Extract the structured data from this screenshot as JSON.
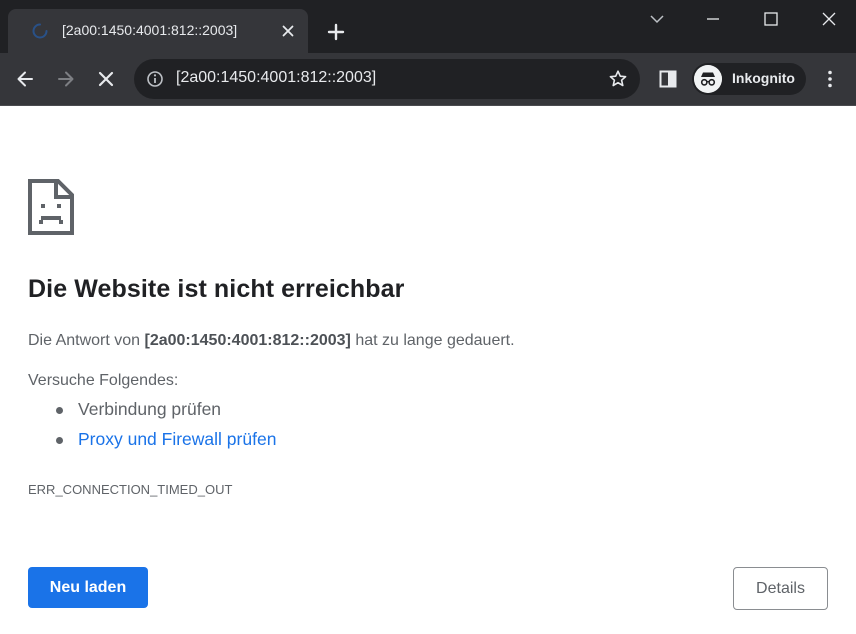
{
  "tab": {
    "title": "[2a00:1450:4001:812::2003]"
  },
  "omnibox": {
    "url": "[2a00:1450:4001:812::2003]"
  },
  "profile": {
    "label": "Inkognito"
  },
  "icons": {
    "tab_loading": "spinner-icon",
    "tab_close": "close-icon",
    "new_tab": "plus-icon",
    "tab_search": "chevron-down-icon",
    "minimize": "minimize-icon",
    "maximize": "maximize-icon",
    "close_window": "close-icon",
    "back": "arrow-left-icon",
    "forward": "arrow-right-icon",
    "stop": "close-icon",
    "site_info": "info-icon",
    "bookmark": "star-icon",
    "side_panel": "side-panel-icon",
    "incognito": "incognito-icon",
    "menu": "kebab-menu-icon",
    "error": "sad-page-icon"
  },
  "error": {
    "headline": "Die Website ist nicht erreichbar",
    "message_prefix": "Die Antwort von ",
    "message_host": "[2a00:1450:4001:812::2003]",
    "message_suffix": " hat zu lange gedauert.",
    "try_label": "Versuche Folgendes:",
    "suggestions": [
      {
        "text": "Verbindung prüfen"
      },
      {
        "text": "Proxy und Firewall prüfen"
      }
    ],
    "code": "ERR_CONNECTION_TIMED_OUT"
  },
  "buttons": {
    "reload": "Neu laden",
    "details": "Details"
  },
  "colors": {
    "chrome_dark": "#202124",
    "chrome_toolbar": "#35363a",
    "accent_blue": "#1a73e8",
    "text_secondary": "#5f6368",
    "text_primary": "#202124"
  }
}
